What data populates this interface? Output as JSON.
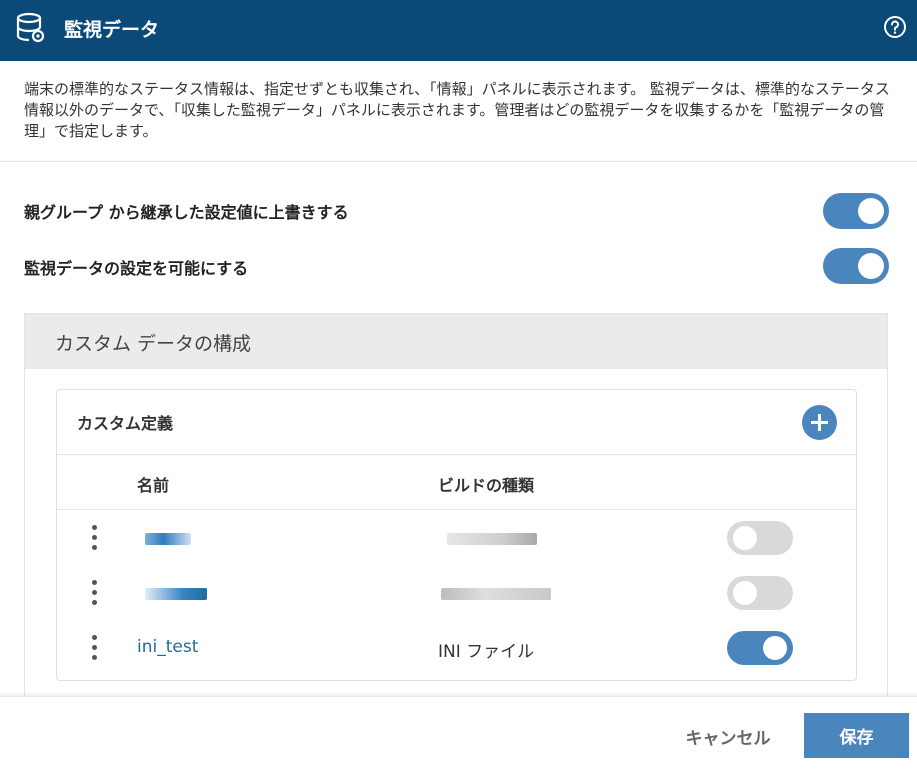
{
  "header": {
    "title": "監視データ",
    "icon": "database-gear-icon",
    "help_icon": "help-circle-icon"
  },
  "description": "端末の標準的なステータス情報は、指定せずとも収集され、「情報」パネルに表示されます。 監視データは、標準的なステータス情報以外のデータで、「収集した監視データ」パネルに表示されます。管理者はどの監視データを収集するかを「監視データの管理」で指定します。",
  "options": [
    {
      "label": "親グループ              から継承した設定値に上書きする",
      "enabled": true
    },
    {
      "label": "監視データの設定を可能にする",
      "enabled": true
    }
  ],
  "panel": {
    "title": "カスタム データの構成",
    "card": {
      "title": "カスタム定義",
      "columns": {
        "name": "名前",
        "type": "ビルドの種類"
      },
      "rows": [
        {
          "name": "",
          "type": "",
          "enabled": false,
          "redacted": true
        },
        {
          "name": "",
          "type": "",
          "enabled": false,
          "redacted": true
        },
        {
          "name": "ini_test",
          "type": "INI ファイル",
          "enabled": true,
          "redacted": false
        }
      ]
    }
  },
  "footer": {
    "cancel_label": "キャンセル",
    "save_label": "保存"
  },
  "colors": {
    "header_bg": "#0b4a78",
    "accent": "#4a86bd",
    "link": "#1f6aa0"
  }
}
